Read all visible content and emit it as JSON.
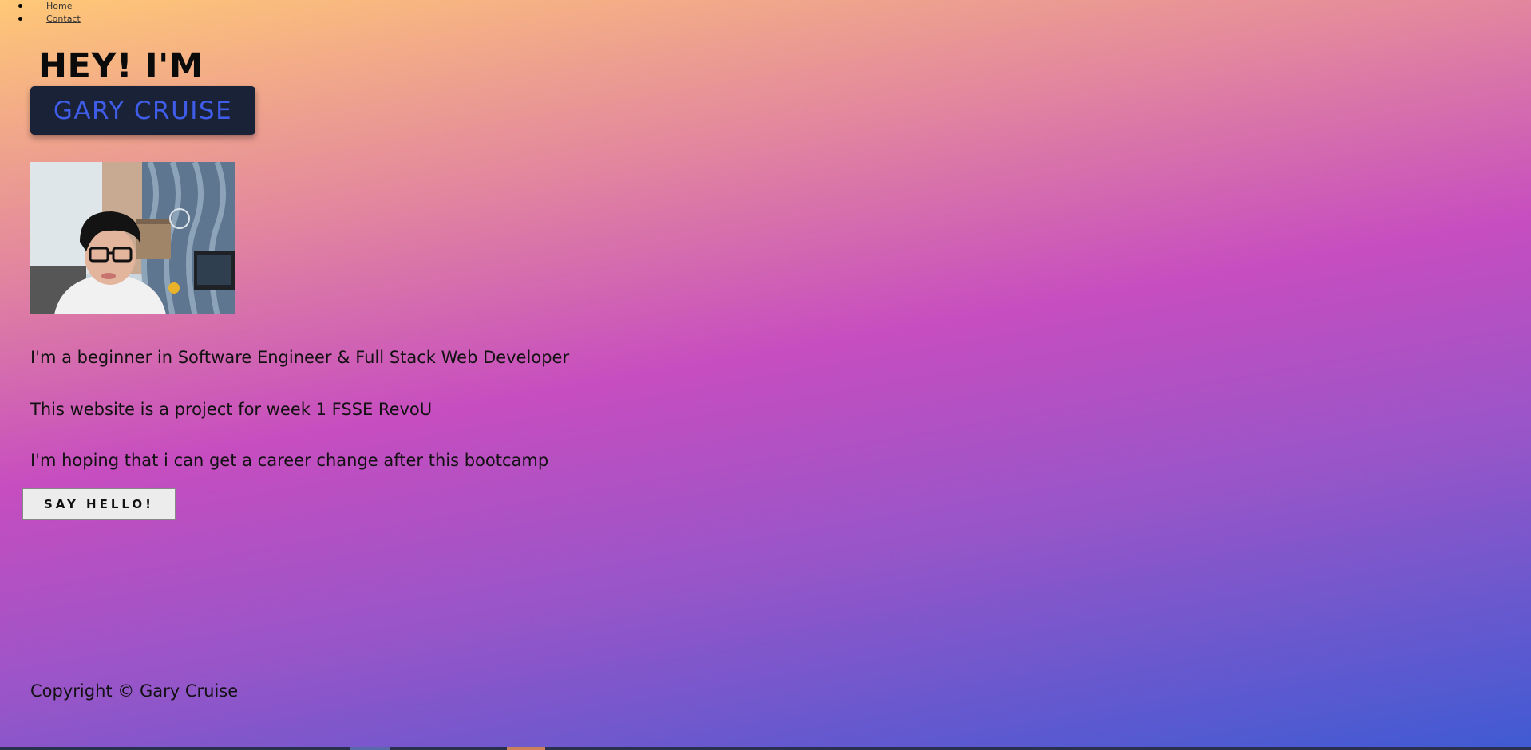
{
  "nav": {
    "items": [
      {
        "label": "Home"
      },
      {
        "label": "Contact"
      }
    ]
  },
  "hero": {
    "greeting": "HEY! I'M",
    "name": "GARY CRUISE"
  },
  "bio": {
    "lines": [
      "I'm a beginner in Software Engineer & Full Stack Web Developer",
      "This website is a project for week 1 FSSE RevoU",
      "I'm hoping that i can get a career change after this bootcamp"
    ]
  },
  "cta": {
    "label": "SAY HELLO!"
  },
  "footer": {
    "copyright": "Copyright © Gary Cruise"
  }
}
